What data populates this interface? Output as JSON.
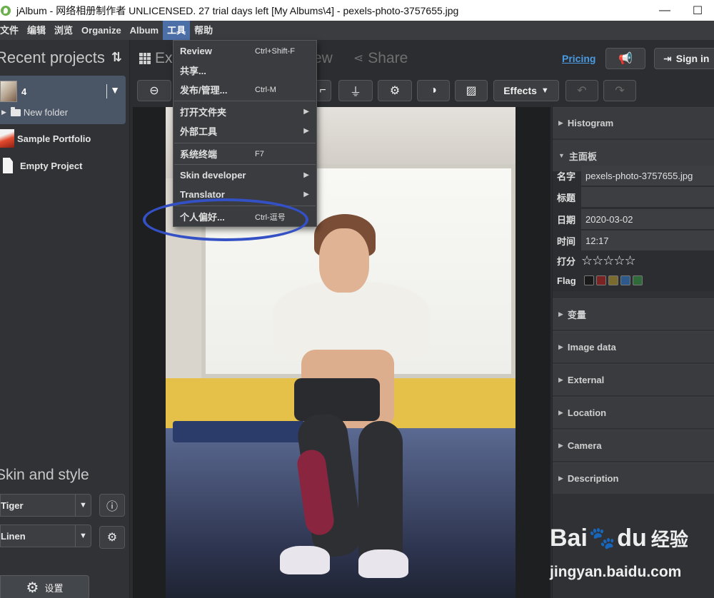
{
  "window": {
    "title": "jAlbum - 网络相册制作者 UNLICENSED. 27 trial days left [My Albums\\4] - pexels-photo-3757655.jpg",
    "controls": {
      "minimize": "—",
      "maximize": "☐",
      "close": "✕"
    }
  },
  "menubar": {
    "items": [
      "文件",
      "编辑",
      "浏览",
      "Organize",
      "Album",
      "工具",
      "帮助"
    ],
    "active": "工具"
  },
  "tools_menu": {
    "items": [
      {
        "label": "Review",
        "shortcut": "Ctrl+Shift-F",
        "submenu": false
      },
      {
        "label": "共享...",
        "shortcut": "",
        "submenu": false
      },
      {
        "label": "发布/管理...",
        "shortcut": "Ctrl-M",
        "submenu": false
      },
      {
        "label": "打开文件夹",
        "shortcut": "",
        "submenu": true
      },
      {
        "label": "外部工具",
        "shortcut": "",
        "submenu": true
      },
      {
        "label": "系统终端",
        "shortcut": "F7",
        "submenu": false
      },
      {
        "label": "Skin developer",
        "shortcut": "",
        "submenu": true
      },
      {
        "label": "Translator",
        "shortcut": "",
        "submenu": true
      },
      {
        "label": "个人偏好...",
        "shortcut": "Ctrl-逗号",
        "submenu": false
      }
    ]
  },
  "left_panel": {
    "recent_title": "Recent projects",
    "sort_icon": "sort-arrows-icon",
    "selected_project": {
      "name": "4",
      "folder": "New folder"
    },
    "projects": [
      "Sample Portfolio",
      "Empty Project"
    ],
    "skin_title": "Skin and style",
    "skin_value": "Tiger",
    "style_value": "Linen",
    "settings_label": "设置"
  },
  "tabs": {
    "explore": "Ex",
    "preview_tail": "ew",
    "share": "Share",
    "pricing": "Pricing",
    "sign_in": "Sign in"
  },
  "toolbar": {
    "effects": "Effects"
  },
  "right_panel": {
    "histogram": "Histogram",
    "main_panel": "主面板",
    "fields": [
      {
        "label": "名字",
        "value": "pexels-photo-3757655.jpg"
      },
      {
        "label": "标题",
        "value": ""
      },
      {
        "label": "日期",
        "value": "2020-03-02"
      },
      {
        "label": "时间",
        "value": "12:17"
      }
    ],
    "rating_label": "打分",
    "rating_stars": "☆☆☆☆☆",
    "rating_value": 0,
    "flag_label": "Flag",
    "flag_colors": [
      "#1a1a1a",
      "#7a2323",
      "#7a6a2e",
      "#2e5a8a",
      "#2e6a3a"
    ],
    "sections": [
      "变量",
      "Image data",
      "External",
      "Location",
      "Camera",
      "Description"
    ]
  },
  "watermark": {
    "brand": "Bai",
    "brand2": "du",
    "cn": "经验",
    "url": "jingyan.baidu.com"
  }
}
